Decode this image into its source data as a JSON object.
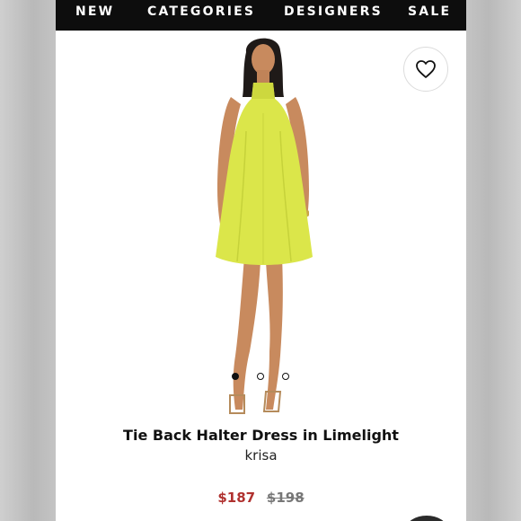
{
  "nav": {
    "items": [
      "NEW",
      "CATEGORIES",
      "DESIGNERS",
      "SALE"
    ]
  },
  "product": {
    "title": "Tie Back Halter Dress in Limelight",
    "brand": "krisa",
    "price_sale": "$187",
    "price_original": "$198",
    "dress_color": "#dbe64a",
    "image_count": 3,
    "active_image": 1
  },
  "icons": {
    "favorite": "heart-outline-icon"
  },
  "colors": {
    "nav_bg": "#0d0d0d",
    "sale_price": "#b0312f",
    "original_price": "#777777"
  }
}
